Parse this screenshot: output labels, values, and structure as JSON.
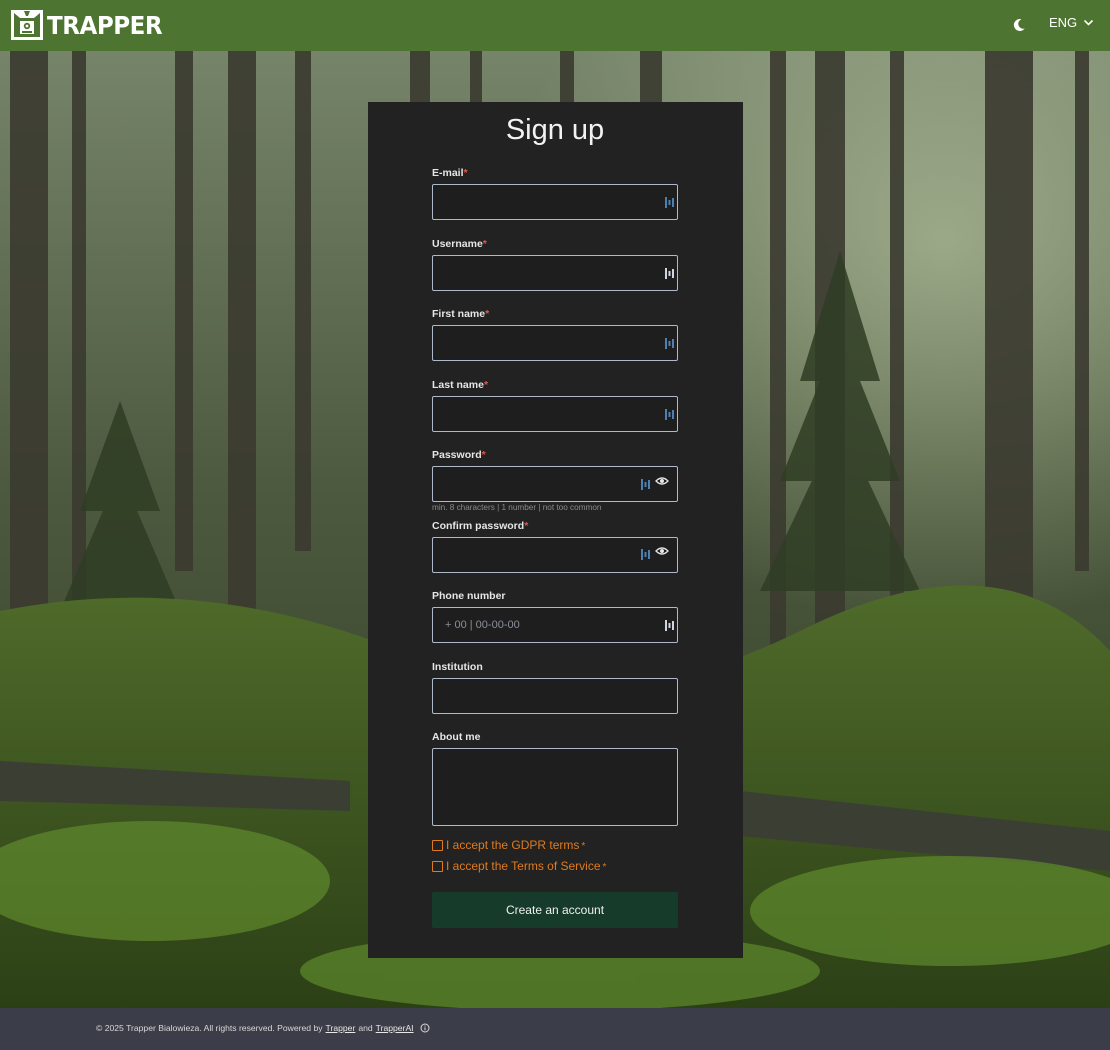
{
  "header": {
    "brand": "TRAPPER",
    "language": "ENG",
    "icons": {
      "logo": "trapper-camera-logo",
      "theme": "moon-icon",
      "chevron": "chevron-down-icon"
    }
  },
  "form": {
    "title": "Sign up",
    "fields": {
      "email": {
        "label": "E-mail",
        "required": "*",
        "value": ""
      },
      "username": {
        "label": "Username",
        "required": "*",
        "value": ""
      },
      "first_name": {
        "label": "First name",
        "required": "*",
        "value": ""
      },
      "last_name": {
        "label": "Last name",
        "required": "*",
        "value": ""
      },
      "password": {
        "label": "Password",
        "required": "*",
        "value": "",
        "hint": "min. 8 characters | 1 number | not too common"
      },
      "confirm_password": {
        "label": "Confirm password",
        "required": "*",
        "value": ""
      },
      "phone": {
        "label": "Phone number",
        "placeholder": "+ 00 | 00-00-00",
        "value": ""
      },
      "institution": {
        "label": "Institution",
        "value": ""
      },
      "about": {
        "label": "About me",
        "value": ""
      }
    },
    "consents": {
      "gdpr": {
        "label": "I accept the GDPR terms",
        "required": "*",
        "checked": false
      },
      "tos": {
        "label": "I accept the Terms of Service",
        "required": "*",
        "checked": false
      }
    },
    "submit_label": "Create an account"
  },
  "footer": {
    "copyright": "© 2025 Trapper Bialowieza. All rights reserved. Powered by",
    "link_trapper": "Trapper",
    "conjunction": "and",
    "link_trapperai": "TrapperAI"
  },
  "colors": {
    "header_bg": "#4d7430",
    "card_bg": "#222222",
    "footer_bg": "#3b3e48",
    "accent_orange": "#e07a1f",
    "required_red": "#e0574f",
    "button_bg": "#163b2a"
  }
}
